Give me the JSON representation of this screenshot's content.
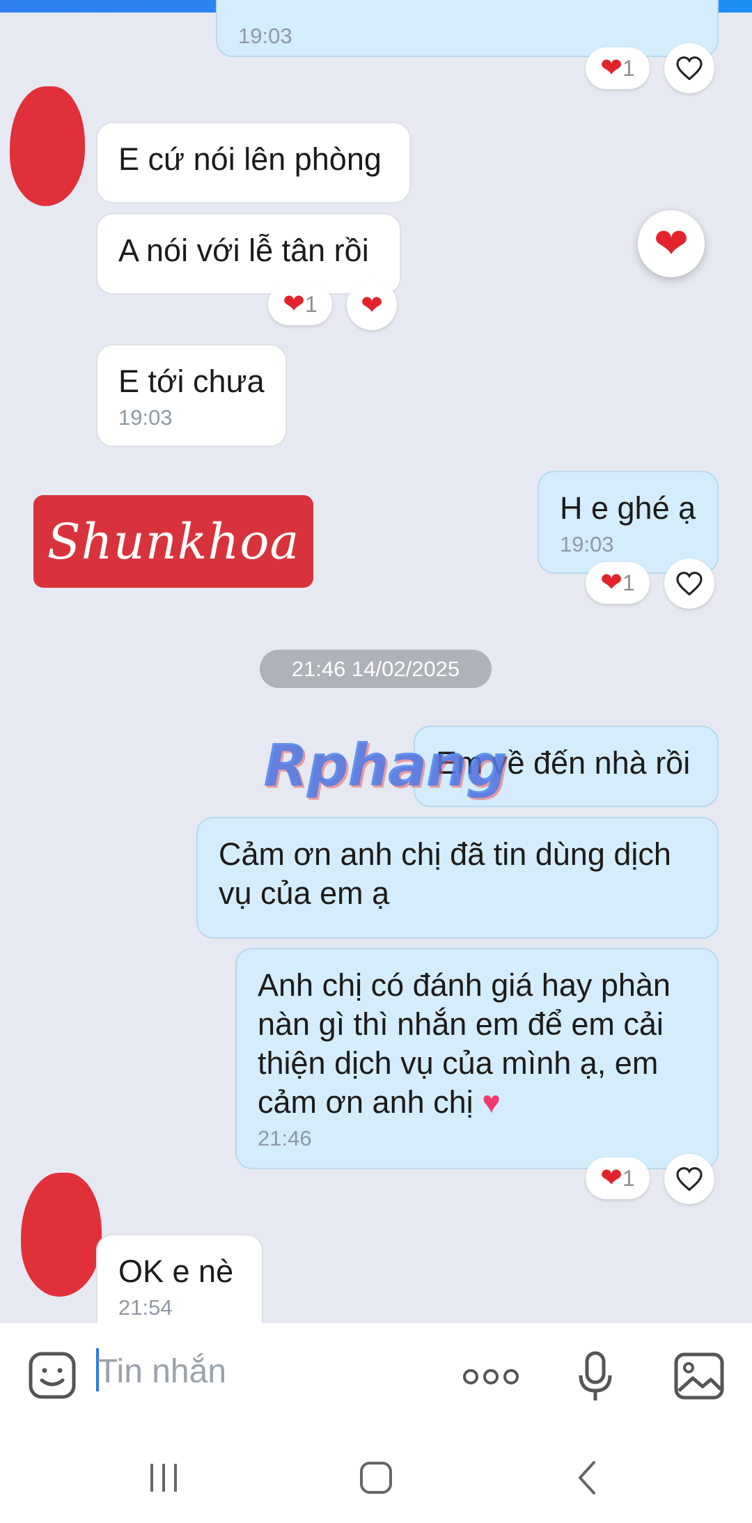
{
  "messages": [
    {
      "id": "m0",
      "time": "19:03"
    },
    {
      "id": "m1",
      "text": "E cứ nói lên phòng"
    },
    {
      "id": "m2",
      "text": "A nói với lễ tân rồi"
    },
    {
      "id": "m3",
      "text": "E tới chưa",
      "time": "19:03"
    },
    {
      "id": "m4",
      "text": "H e ghé ạ",
      "time": "19:03"
    },
    {
      "id": "m5",
      "text": "Em về đến nhà rồi"
    },
    {
      "id": "m6",
      "text": "Cảm ơn anh chị đã tin dùng dịch vụ của em ạ"
    },
    {
      "id": "m7",
      "text": "Anh chị có đánh giá hay phàn nàn gì thì nhắn em để em cải thiện dịch vụ của mình ạ, em cảm ơn anh chị",
      "time": "21:46"
    },
    {
      "id": "m8",
      "text": "OK e nè",
      "time": "21:54"
    }
  ],
  "reactions": {
    "heart_count": "1",
    "heart_glyph": "❤"
  },
  "date_separator": "21:46 14/02/2025",
  "watermarks": {
    "box_text": "Shunkhoa",
    "overlay_text": "Rphang"
  },
  "composer": {
    "placeholder": "Tin nhắn"
  },
  "colors": {
    "incoming_bubble": "#ffffff",
    "outgoing_bubble": "#d4ecfb",
    "reaction_heart": "#e2232b",
    "avatar_redaction": "#e1303a"
  }
}
